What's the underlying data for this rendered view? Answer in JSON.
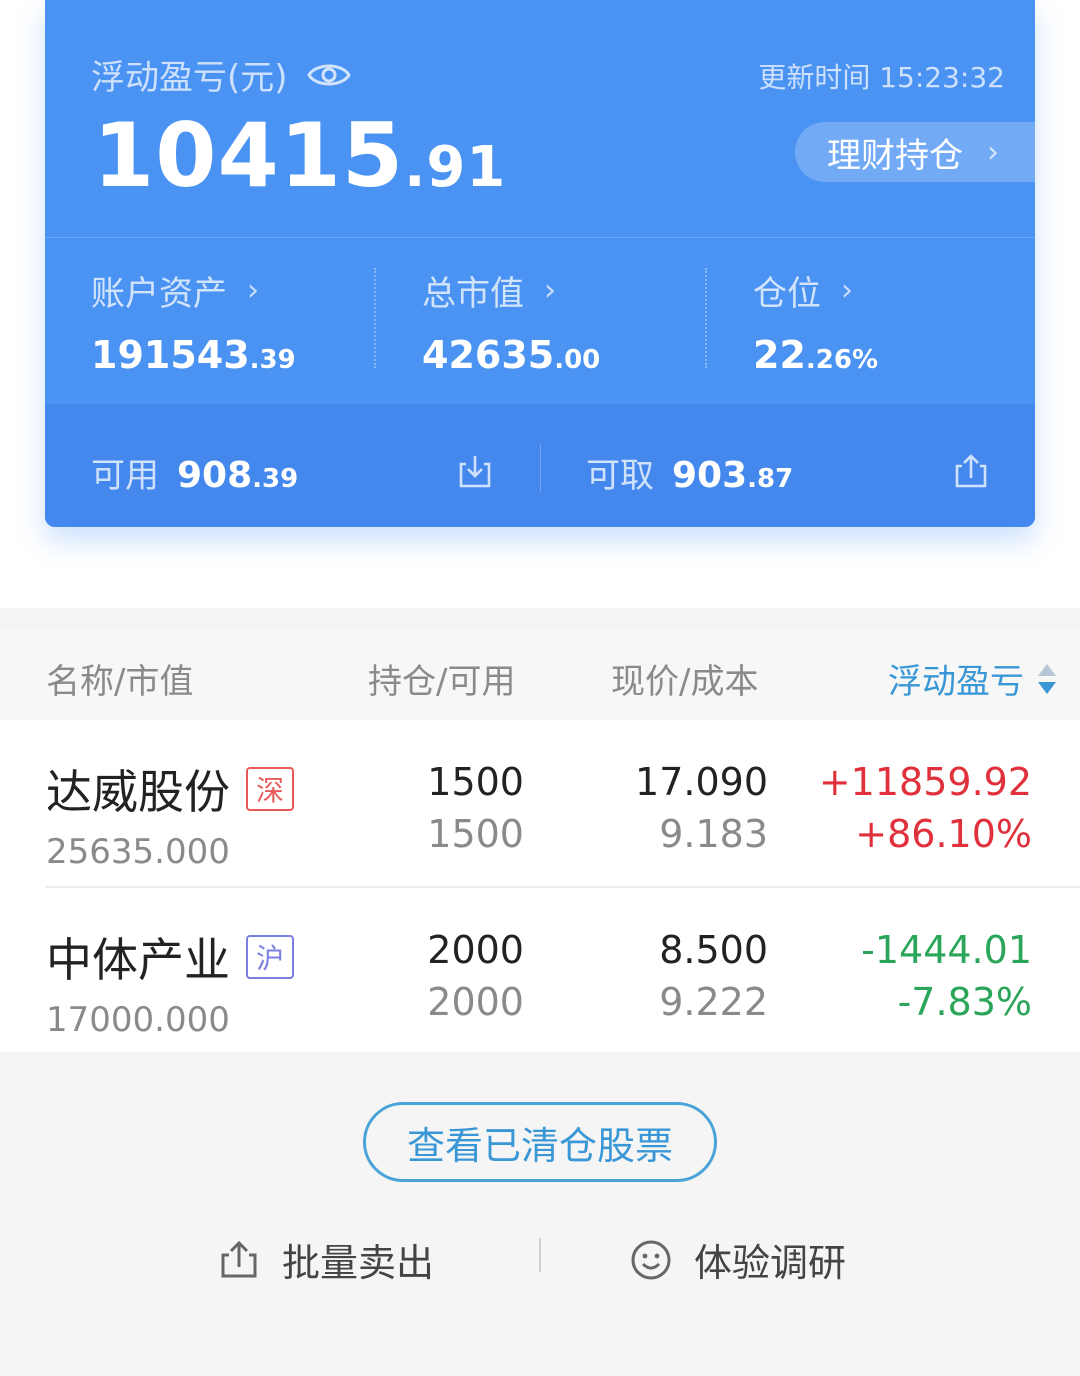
{
  "summary": {
    "pl_label": "浮动盈亏(元)",
    "update_time": "更新时间 15:23:32",
    "pl_int": "10415",
    "pl_dec": ".91",
    "fin_holdings": "理财持仓",
    "account_assets": {
      "label": "账户资产",
      "int": "191543",
      "dec": ".39"
    },
    "market_value": {
      "label": "总市值",
      "int": "42635",
      "dec": ".00"
    },
    "position": {
      "label": "仓位",
      "int": "22",
      "dec": ".26%"
    },
    "available": {
      "label": "可用",
      "int": "908",
      "dec": ".39"
    },
    "withdrawable": {
      "label": "可取",
      "int": "903",
      "dec": ".87"
    }
  },
  "table": {
    "headers": {
      "name": "名称/市值",
      "hold": "持仓/可用",
      "price": "现价/成本",
      "pl": "浮动盈亏"
    },
    "rows": [
      {
        "name": "达威股份",
        "market": "深",
        "market_value": "25635.000",
        "hold": "1500",
        "available": "1500",
        "price": "17.090",
        "cost": "9.183",
        "pl": "+11859.92",
        "pl_pct": "+86.10%"
      },
      {
        "name": "中体产业",
        "market": "沪",
        "market_value": "17000.000",
        "hold": "2000",
        "available": "2000",
        "price": "8.500",
        "cost": "9.222",
        "pl": "-1444.01",
        "pl_pct": "-7.83%"
      }
    ]
  },
  "footer": {
    "cleared_button": "查看已清仓股票",
    "batch_sell": "批量卖出",
    "research": "体验调研"
  },
  "colors": {
    "card_blue": "#4b93f3",
    "up_red": "#e0303b",
    "down_green": "#2aa55a",
    "link_blue": "#3a97d6",
    "sz_badge": "#e85a5a",
    "sh_badge": "#7b7fe0"
  }
}
